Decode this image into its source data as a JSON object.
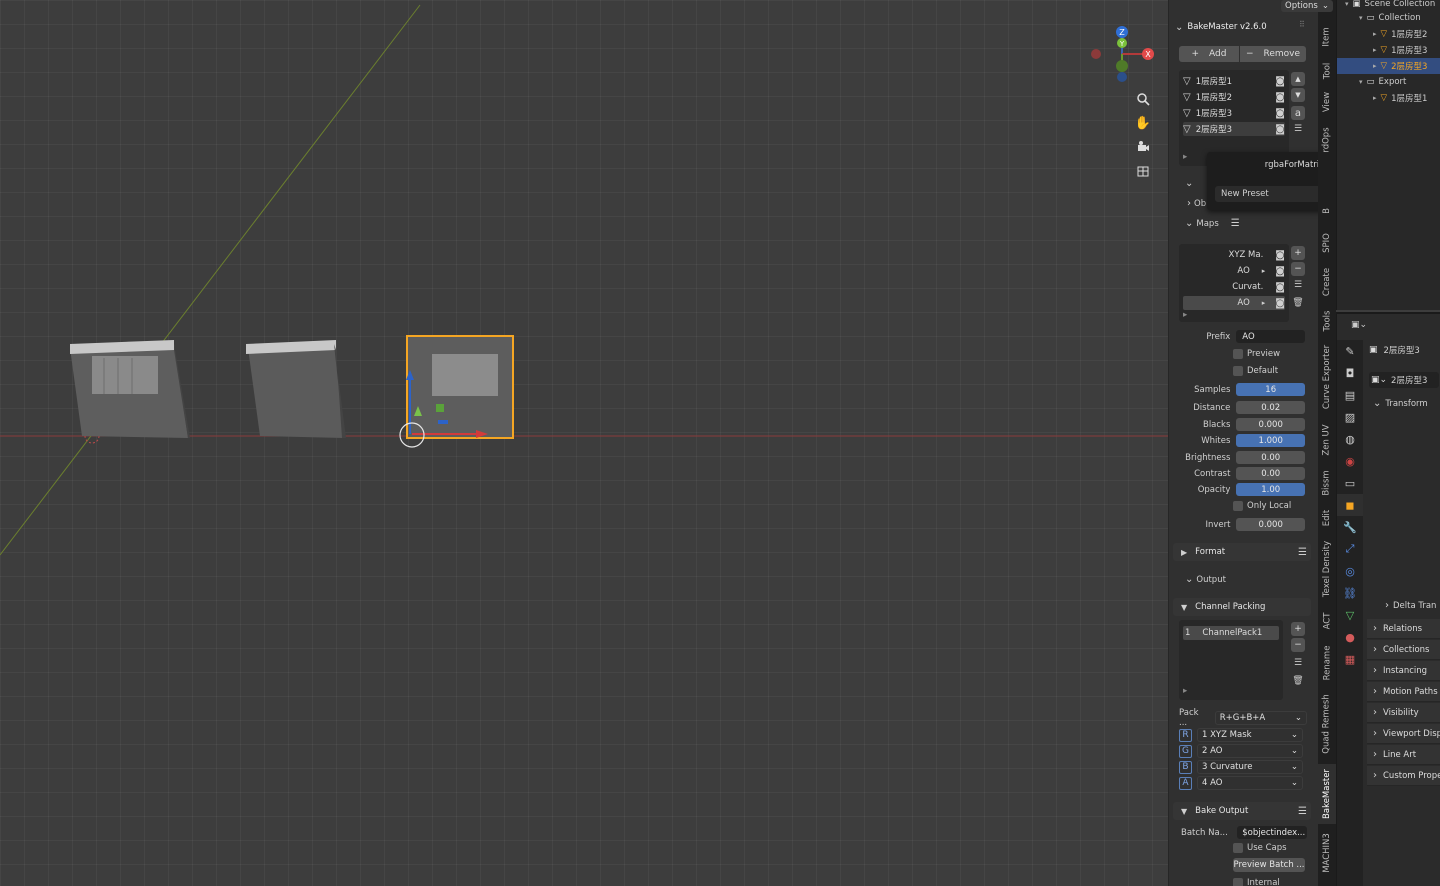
{
  "viewport": {
    "options_label": "Options",
    "gizmo_axes": {
      "z": "Z",
      "x": "X",
      "y": "Y"
    },
    "nav_icons": [
      "zoom-icon",
      "hand-icon",
      "camera-icon",
      "grid-icon"
    ],
    "colors": {
      "selection": "#f5a623",
      "x_axis": "#c0392b",
      "y_axis": "#7fa82b"
    }
  },
  "npanel": {
    "title": "BakeMaster v2.6.0",
    "add_label": "Add",
    "remove_label": "Remove",
    "objects": [
      "1层房型1",
      "1层房型2",
      "1层房型3",
      "2层房型3"
    ],
    "selected_object": "2层房型3",
    "ob_label": "Ob",
    "maps_label": "Maps",
    "maps": [
      "XYZ Ma.",
      "AO",
      "Curvat.",
      "AO"
    ],
    "prefix_label": "Prefix",
    "prefix_value": "AO",
    "preview_label": "Preview",
    "default_label": "Default",
    "fields": [
      {
        "label": "Samples",
        "value": "16",
        "accent": true
      },
      {
        "label": "Distance",
        "value": "0.02",
        "accent": false
      },
      {
        "label": "Blacks",
        "value": "0.000",
        "accent": false
      },
      {
        "label": "Whites",
        "value": "1.000",
        "accent": true
      },
      {
        "label": "Brightness",
        "value": "0.00",
        "accent": false
      },
      {
        "label": "Contrast",
        "value": "0.00",
        "accent": false
      },
      {
        "label": "Opacity",
        "value": "1.00",
        "accent": true
      }
    ],
    "only_local_label": "Only Local",
    "invert_label": "Invert",
    "invert_value": "0.000",
    "format_label": "Format",
    "output_label": "Output",
    "channel_packing_label": "Channel Packing",
    "channel_pack_index": "1",
    "channel_pack_name": "ChannelPack1",
    "pack_label": "Pack ...",
    "pack_value": "R+G+B+A",
    "channels": [
      {
        "tag": "R",
        "value": "1 XYZ Mask"
      },
      {
        "tag": "G",
        "value": "2 AO"
      },
      {
        "tag": "B",
        "value": "3 Curvature"
      },
      {
        "tag": "A",
        "value": "4 AO"
      }
    ],
    "bake_output_label": "Bake Output",
    "batch_label": "Batch Na...",
    "batch_value": "$objectindex...",
    "use_caps_label": "Use Caps",
    "preview_batch_label": "Preview Batch ...",
    "internal_label": "Internal"
  },
  "popup": {
    "title": "rgbaForMatrix",
    "new_preset": "New Preset"
  },
  "tabs": [
    "Item",
    "Tool",
    "View",
    "rdOps",
    "B",
    "SPIO",
    "Create",
    "Tools",
    "Curve Exporter",
    "Zen UV",
    "Bissm",
    "Edit",
    "Texel Density",
    "ACT",
    "Rename",
    "Quad Remesh",
    "BakeMaster",
    "MACHIN3"
  ],
  "outliner": {
    "rows": [
      {
        "label": "Scene Collection",
        "indent": 0,
        "icon": "scene",
        "selected": false
      },
      {
        "label": "Collection",
        "indent": 1,
        "icon": "collection",
        "selected": false
      },
      {
        "label": "1层房型2",
        "indent": 2,
        "icon": "mesh",
        "selected": false
      },
      {
        "label": "1层房型3",
        "indent": 2,
        "icon": "mesh",
        "selected": false
      },
      {
        "label": "2层房型3",
        "indent": 2,
        "icon": "mesh",
        "selected": true
      },
      {
        "label": "Export",
        "indent": 1,
        "icon": "collection",
        "selected": false
      },
      {
        "label": "1层房型1",
        "indent": 2,
        "icon": "mesh",
        "selected": false
      }
    ]
  },
  "properties": {
    "object_name": "2层房型3",
    "data_name": "2层房型3",
    "transform_label": "Transform",
    "delta_label": "Delta Tran",
    "sections": [
      "Relations",
      "Collections",
      "Instancing",
      "Motion Paths",
      "Visibility",
      "Viewport Disp",
      "Line Art",
      "Custom Prope"
    ]
  }
}
